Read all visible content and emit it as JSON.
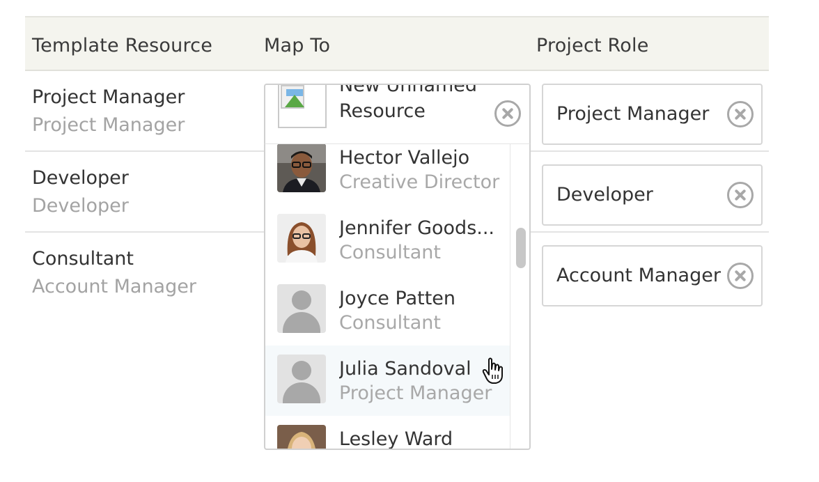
{
  "table": {
    "headers": {
      "template_resource": "Template Resource",
      "map_to": "Map To",
      "project_role": "Project Role"
    },
    "rows": [
      {
        "name": "Project Manager",
        "subtitle": "Project Manager",
        "role": "Project Manager"
      },
      {
        "name": "Developer",
        "subtitle": "Developer",
        "role": "Developer"
      },
      {
        "name": "Consultant",
        "subtitle": "Account Manager",
        "role": "Account Manager"
      }
    ]
  },
  "map_select": {
    "selected": "New Unnamed Resource",
    "options": [
      {
        "name": "Hector Vallejo",
        "role": "Creative Director",
        "avatar": "photo-man-glasses"
      },
      {
        "name": "Jennifer Goods...",
        "role": "Consultant",
        "avatar": "photo-woman-glasses"
      },
      {
        "name": "Joyce Patten",
        "role": "Consultant",
        "avatar": "user-placeholder-icon"
      },
      {
        "name": "Julia Sandoval",
        "role": "Project Manager",
        "avatar": "user-placeholder-icon"
      },
      {
        "name": "Lesley Ward",
        "role": "",
        "avatar": "photo-woman-blonde"
      }
    ]
  },
  "colors": {
    "header_bg": "#f4f4ee",
    "hover_bg": "#f5f9fb",
    "muted_text": "#a3a3a3",
    "border": "#d6d6d6"
  }
}
